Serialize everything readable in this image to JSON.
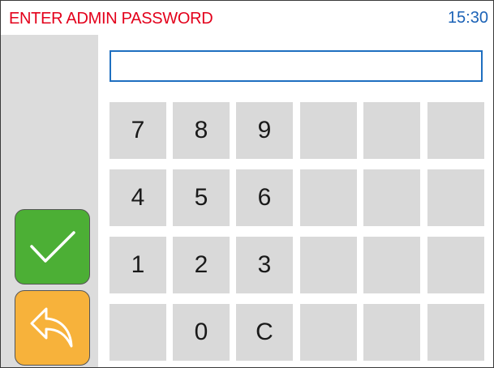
{
  "header": {
    "title": "ENTER ADMIN PASSWORD",
    "time": "15:30"
  },
  "password": {
    "value": "",
    "placeholder": ""
  },
  "keypad": {
    "k7": "7",
    "k8": "8",
    "k9": "9",
    "k4": "4",
    "k5": "5",
    "k6": "6",
    "k1": "1",
    "k2": "2",
    "k3": "3",
    "k0": "0",
    "clear": "C"
  },
  "actions": {
    "confirm_icon": "checkmark-icon",
    "back_icon": "back-arrow-icon"
  },
  "colors": {
    "title": "#e3001b",
    "clock": "#1c63b7",
    "input_border": "#1f6fc0",
    "confirm": "#4caf35",
    "back": "#f7b23b",
    "key": "#d9d9d9",
    "sidebar": "#dcdcdc"
  }
}
